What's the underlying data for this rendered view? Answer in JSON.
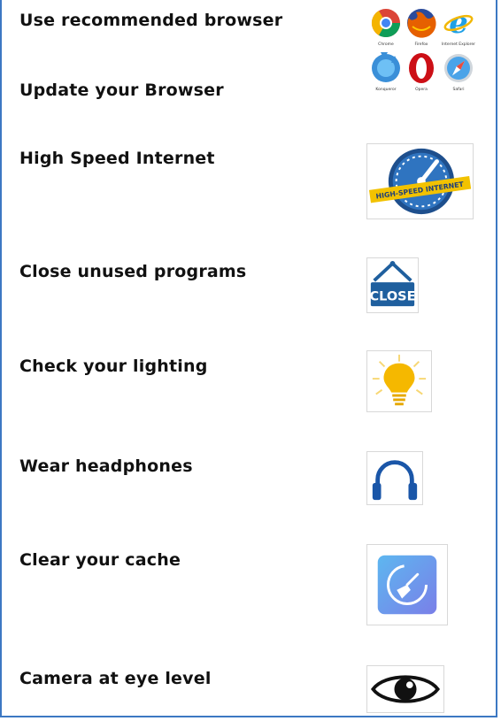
{
  "items": [
    {
      "label": "Use recommended browser",
      "icon": "browser-logos-icon"
    },
    {
      "label": "Update your Browser",
      "icon": "browser-logos-icon"
    },
    {
      "label": "High Speed Internet",
      "icon": "high-speed-internet-gauge-icon"
    },
    {
      "label": "Close unused programs",
      "icon": "close-sign-icon"
    },
    {
      "label": "Check your lighting",
      "icon": "light-bulb-icon"
    },
    {
      "label": "Wear headphones",
      "icon": "headphones-icon"
    },
    {
      "label": "Clear your cache",
      "icon": "cleaner-broom-icon"
    },
    {
      "label": "Camera at eye level",
      "icon": "eye-icon"
    }
  ],
  "browser_logos": {
    "names": [
      "Chrome",
      "Firefox",
      "Internet Explorer",
      "Konqueror",
      "Opera",
      "Safari"
    ]
  },
  "speed_badge": {
    "text": "HIGH-SPEED INTERNET"
  },
  "close_sign": {
    "text": "CLOSE"
  },
  "colors": {
    "frame_border": "#3c78c3",
    "label_text": "#111111",
    "sign_blue": "#1f5f9e",
    "bulb_yellow": "#f5b800",
    "headphone_blue": "#1a56a8",
    "cache_gradient_start": "#5db7f0",
    "cache_gradient_end": "#7a7fe8"
  }
}
